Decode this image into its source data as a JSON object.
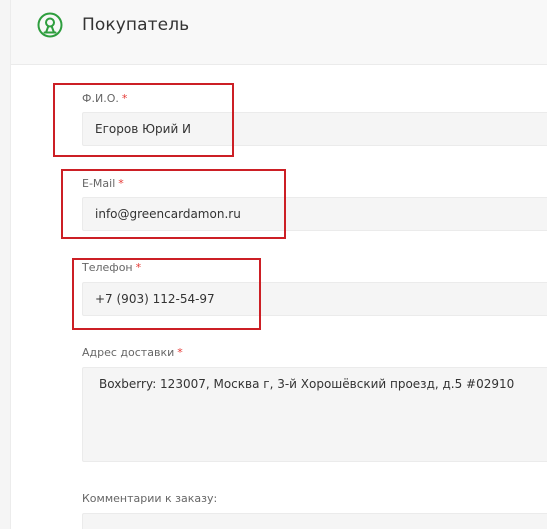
{
  "header": {
    "title": "Покупатель"
  },
  "fields": {
    "fio": {
      "label": "Ф.И.О.",
      "required_mark": "*",
      "value": "Егоров Юрий И"
    },
    "email": {
      "label": "E-Mail",
      "required_mark": "*",
      "value": "info@greencardamon.ru"
    },
    "phone": {
      "label": "Телефон",
      "required_mark": "*",
      "value": "+7 (903) 112-54-97"
    },
    "address": {
      "label": "Адрес доставки",
      "required_mark": "*",
      "value": "Boxberry: 123007, Москва г, 3-й Хорошёвский проезд, д.5 #02910"
    },
    "comment": {
      "label": "Комментарии к заказу:",
      "value": ""
    }
  },
  "colors": {
    "accent_green": "#2e9e3e",
    "highlight_red": "#cc1f25",
    "required_red": "#e53935"
  }
}
